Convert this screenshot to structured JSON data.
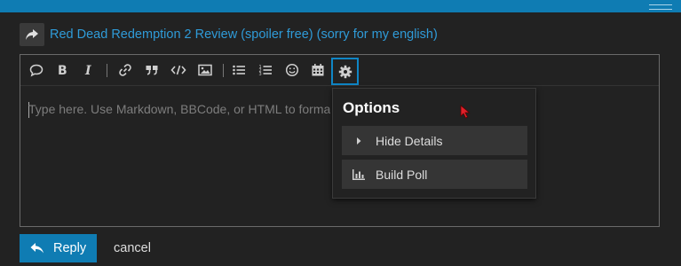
{
  "header": {
    "topic_title": "Red Dead Redemption 2 Review (spoiler free) (sorry for my english)"
  },
  "composer": {
    "placeholder": "Type here. Use Markdown, BBCode, or HTML to format. Drag or paste images.",
    "toolbar": [
      {
        "name": "quote",
        "icon": "speech-bubble-icon"
      },
      {
        "name": "bold",
        "icon": "bold-icon"
      },
      {
        "name": "italic",
        "icon": "italic-icon"
      },
      {
        "name": "link",
        "icon": "link-icon"
      },
      {
        "name": "blockquote",
        "icon": "quote-icon"
      },
      {
        "name": "code",
        "icon": "code-icon"
      },
      {
        "name": "image",
        "icon": "image-icon"
      },
      {
        "name": "bullet-list",
        "icon": "bullet-list-icon"
      },
      {
        "name": "numbered-list",
        "icon": "numbered-list-icon"
      },
      {
        "name": "emoji",
        "icon": "smiley-icon"
      },
      {
        "name": "date",
        "icon": "calendar-icon"
      },
      {
        "name": "options",
        "icon": "gear-icon"
      }
    ]
  },
  "options_menu": {
    "title": "Options",
    "items": [
      {
        "label": "Hide Details",
        "icon": "caret-right-icon"
      },
      {
        "label": "Build Poll",
        "icon": "bar-chart-icon"
      }
    ]
  },
  "footer": {
    "reply_label": "Reply",
    "cancel_label": "cancel"
  },
  "colors": {
    "accent": "#0f7cb3",
    "link": "#2f9bd8",
    "background": "#222222"
  }
}
